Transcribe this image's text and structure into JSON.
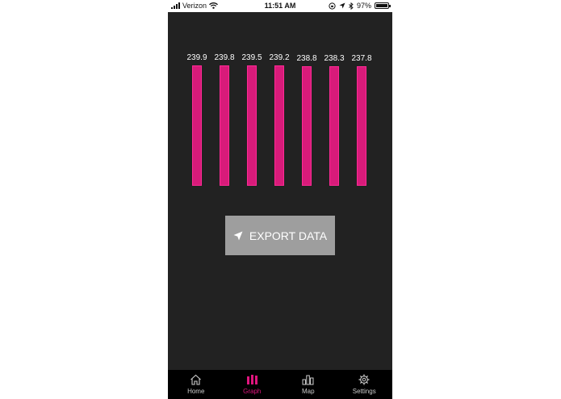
{
  "status_bar": {
    "carrier": "Verizon",
    "time": "11:51 AM",
    "battery": "97%",
    "battery_level": 0.97,
    "icons": [
      "signal-icon",
      "wifi-icon",
      "orientation-lock-icon",
      "location-icon",
      "bluetooth-icon",
      "battery-icon"
    ]
  },
  "chart_data": {
    "type": "bar",
    "categories": [
      "",
      "",
      "",
      "",
      "",
      "",
      ""
    ],
    "values": [
      239.9,
      239.8,
      239.5,
      239.2,
      238.8,
      238.3,
      237.8
    ],
    "data_labels": [
      "239.9",
      "239.8",
      "239.5",
      "239.2",
      "238.8",
      "238.3",
      "237.8"
    ],
    "title": "",
    "xlabel": "",
    "ylabel": "",
    "ylim": [
      0,
      239.9
    ],
    "grid": false,
    "bar_color": "#d81b7a",
    "bar_border_color": "#ff2a95"
  },
  "export_button": {
    "label": "EXPORT DATA",
    "icon": "send-icon"
  },
  "tab_bar": {
    "active_color": "#e0157e",
    "items": [
      {
        "label": "Home",
        "icon": "home-icon"
      },
      {
        "label": "Graph",
        "icon": "graph-icon",
        "active": true
      },
      {
        "label": "Map",
        "icon": "map-icon"
      },
      {
        "label": "Settings",
        "icon": "gear-icon"
      }
    ]
  },
  "colors": {
    "background": "#222222",
    "tab_bar": "#000000",
    "button": "#9e9e9e",
    "accent": "#e0157e"
  }
}
